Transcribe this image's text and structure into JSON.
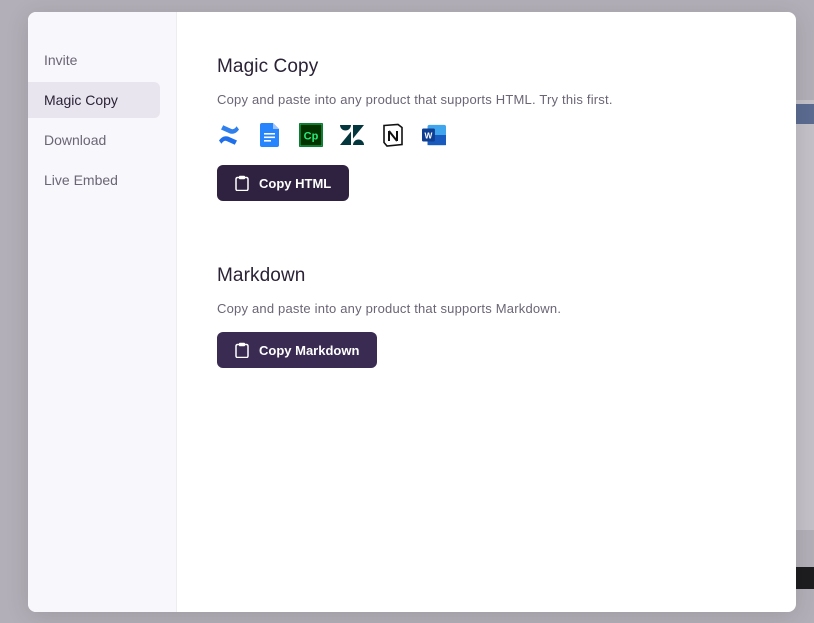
{
  "sidebar": {
    "items": [
      {
        "label": "Invite",
        "active": false
      },
      {
        "label": "Magic Copy",
        "active": true
      },
      {
        "label": "Download",
        "active": false
      },
      {
        "label": "Live Embed",
        "active": false
      }
    ]
  },
  "magic_copy": {
    "title": "Magic Copy",
    "description": "Copy and paste into any product that supports HTML. Try this first.",
    "apps": [
      "confluence-icon",
      "google-docs-icon",
      "captivate-icon",
      "zendesk-icon",
      "notion-icon",
      "word-icon"
    ],
    "button_label": "Copy HTML",
    "button_icon": "clipboard-icon"
  },
  "markdown": {
    "title": "Markdown",
    "description": "Copy and paste into any product that supports Markdown.",
    "button_label": "Copy Markdown",
    "button_icon": "clipboard-icon"
  },
  "colors": {
    "primary_button": "#2e2240",
    "sidebar_active": "#e8e5ee",
    "text_dark": "#2b2236",
    "text_muted": "#6b6575"
  }
}
